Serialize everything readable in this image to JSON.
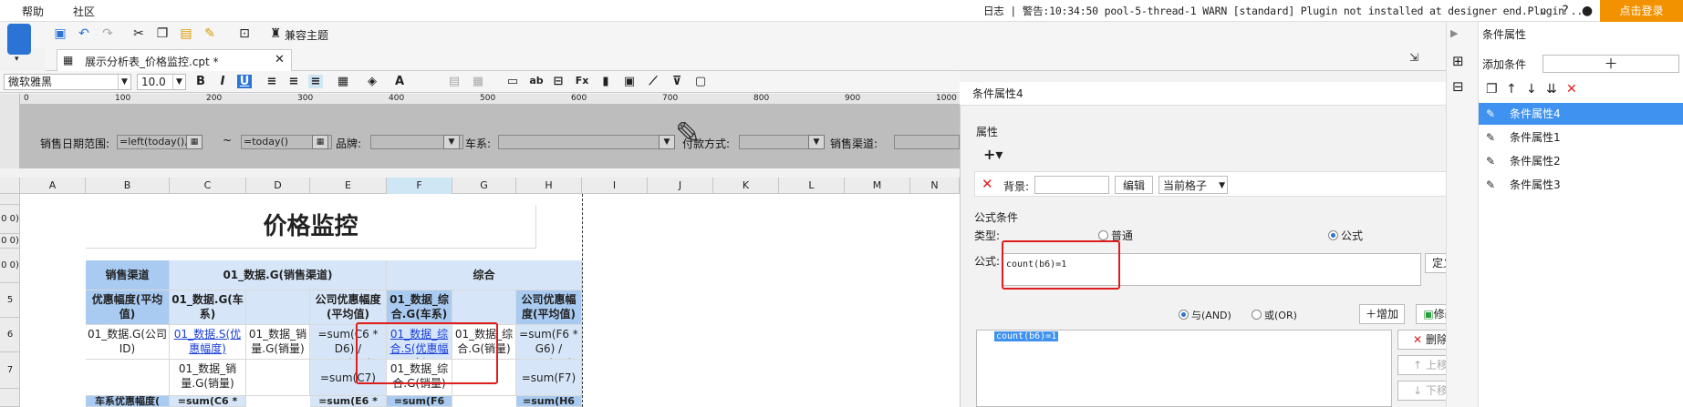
{
  "menu": {
    "help": "帮助",
    "community": "社区"
  },
  "status": {
    "log_label": "日志",
    "warning": "警告:10:34:50 pool-5-thread-1 WARN [standard] Plugin not installed at designer end.Plugin ...",
    "login": "点击登录"
  },
  "toolbar": {
    "compat_theme": "兼容主题"
  },
  "tab": {
    "title": "展示分析表_价格监控.cpt *"
  },
  "font": {
    "family": "微软雅黑",
    "size": "10.0"
  },
  "ruler": {
    "labels": [
      "0",
      "100",
      "200",
      "300",
      "400",
      "500",
      "600",
      "700",
      "800",
      "900",
      "1000"
    ]
  },
  "params": {
    "sales_date_label": "销售日期范围:",
    "date_from": "=left(today(),",
    "tilde": "~",
    "date_to": "=today()",
    "brand_label": "品牌:",
    "car_label": "车系:",
    "pay_label": "付款方式:",
    "channel_label": "销售渠道:"
  },
  "columns": [
    "A",
    "B",
    "C",
    "D",
    "E",
    "F",
    "G",
    "H",
    "I",
    "J",
    "K",
    "L",
    "M",
    "N"
  ],
  "rows": [
    "0 0)",
    "0 0)",
    "0 0)",
    "5",
    "6",
    "7",
    ""
  ],
  "sheet": {
    "title": "价格监控",
    "sales_channel": "销售渠道",
    "g_channel": "01_数据.G(销售渠道)",
    "overall": "综合",
    "discount_avg": "优惠幅度(平均值)",
    "g_car": "01_数据.G(车系)",
    "company_discount_avg": "公司优惠幅度(平均值)",
    "overall_g_car": "01_数据_综合.G(车系)",
    "company_discount_avg2": "公司优惠幅度(平均值)",
    "b6": "01_数据.G(公司ID)",
    "c6": "01_数据.S(优惠幅度)",
    "d6": "01_数据_销量.G(销量)",
    "e6": "=sum(C6 * D6) / sum(D6)",
    "f6": "01_数据_综合.S(优惠幅度)",
    "g6": "01_数据_综合.G(销量)",
    "h6": "=sum(F6 * G6) / sum(G6)",
    "c7": "01_数据_销量.G(销量)",
    "e7": "=sum(C7)",
    "f7": "01_数据_综合.G(销量)",
    "h7": "=sum(F7)",
    "b8": "车系优惠幅度(",
    "c8": "=sum(C6 *",
    "e8": "=sum(E6 *",
    "f8": "=sum(F6",
    "h8": "=sum(H6"
  },
  "dialog": {
    "title": "条件属性4",
    "attr_section": "属性",
    "bg_label": "背景:",
    "edit": "编辑",
    "scope": "当前格子",
    "formula_section": "公式条件",
    "type_label": "类型:",
    "type_normal": "普通",
    "type_formula": "公式",
    "formula_label": "公式:",
    "formula_value": "count(b6)=1",
    "define": "定义",
    "and": "与(AND)",
    "or": "或(OR)",
    "add": "增加",
    "modify": "修改",
    "list_item": "count(b6)=1",
    "delete": "删除",
    "up": "上移",
    "down": "下移"
  },
  "cond_panel": {
    "title": "条件属性",
    "add_label": "添加条件",
    "items": [
      "条件属性4",
      "条件属性1",
      "条件属性2",
      "条件属性3"
    ]
  },
  "colors": {
    "accent": "#3f92f0",
    "header_blue": "#a9cbf2",
    "highlight": "#e01d1d",
    "login": "#f39200"
  }
}
